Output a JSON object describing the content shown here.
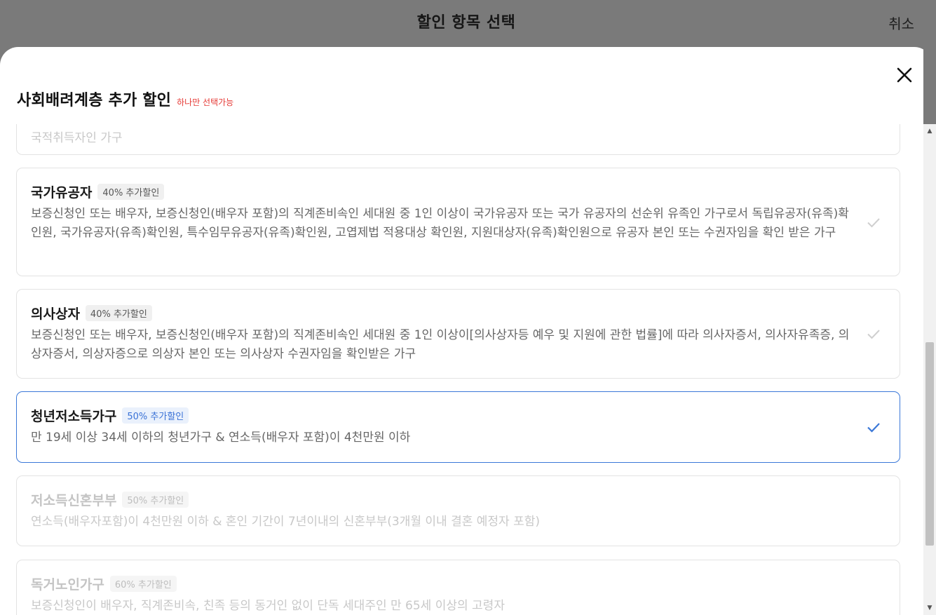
{
  "page": {
    "title": "할인 항목 선택",
    "cancel_label": "취소"
  },
  "modal": {
    "title": "사회배려계층 추가 할인",
    "hint": "하나만 선택가능",
    "close_icon": "close-icon",
    "accent_color": "#3b78d8",
    "hint_color": "#e53935"
  },
  "items": [
    {
      "name": "",
      "badge": "",
      "desc": "국적취득자인 가구",
      "state": "disabled-partial"
    },
    {
      "name": "국가유공자",
      "badge": "40% 추가할인",
      "desc": "보증신청인 또는 배우자, 보증신청인(배우자 포함)의 직계존비속인 세대원 중 1인 이상이 국가유공자 또는 국가 유공자의 선순위 유족인 가구로서 독립유공자(유족)확인원, 국가유공자(유족)확인원, 특수임무유공자(유족)확인원, 고엽제법 적용대상 확인원, 지원대상자(유족)확인원으로 유공자 본인 또는 수권자임을 확인 받은 가구",
      "state": "unselected"
    },
    {
      "name": "의사상자",
      "badge": "40% 추가할인",
      "desc": "보증신청인 또는 배우자, 보증신청인(배우자 포함)의 직계존비속인 세대원 중 1인 이상이[의사상자등 예우 및 지원에 관한 법률]에 따라 의사자증서, 의사자유족증, 의상자증서, 의상자증으로 의상자 본인 또는 의사상자 수권자임을 확인받은 가구",
      "state": "unselected"
    },
    {
      "name": "청년저소득가구",
      "badge": "50% 추가할인",
      "desc": "만 19세 이상 34세 이하의 청년가구 & 연소득(배우자 포함)이 4천만원 이하",
      "state": "selected"
    },
    {
      "name": "저소득신혼부부",
      "badge": "50% 추가할인",
      "desc": "연소득(배우자포함)이 4천만원 이하 & 혼인 기간이 7년이내의 신혼부부(3개월 이내 결혼 예정자 포함)",
      "state": "disabled"
    },
    {
      "name": "독거노인가구",
      "badge": "60% 추가할인",
      "desc": "보증신청인이 배우자, 직계존비속, 친족 등의 동거인 없이 단독 세대주인 만 65세 이상의 고령자",
      "state": "disabled"
    }
  ]
}
